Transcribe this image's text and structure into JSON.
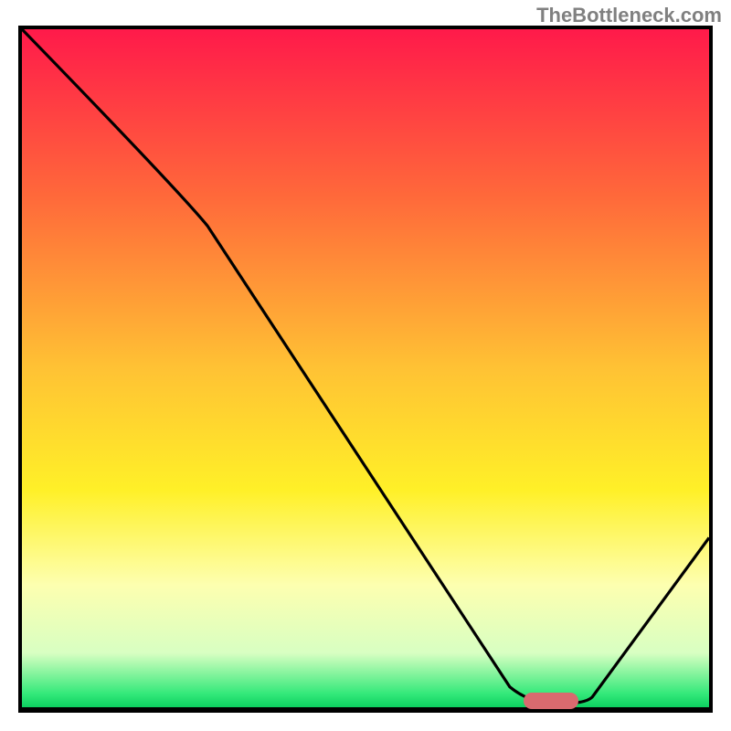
{
  "watermark": "TheBottleneck.com",
  "chart_data": {
    "type": "line",
    "title": "",
    "xlabel": "",
    "ylabel": "",
    "xlim": [
      0,
      100
    ],
    "ylim": [
      0,
      100
    ],
    "gradient_stops": [
      {
        "offset": 0,
        "color": "#ff1a4a"
      },
      {
        "offset": 25,
        "color": "#ff6a3a"
      },
      {
        "offset": 50,
        "color": "#ffc234"
      },
      {
        "offset": 68,
        "color": "#fff028"
      },
      {
        "offset": 82,
        "color": "#fdffb0"
      },
      {
        "offset": 92,
        "color": "#d8ffc2"
      },
      {
        "offset": 98,
        "color": "#34e97a"
      },
      {
        "offset": 100,
        "color": "#0cd060"
      }
    ],
    "curve_points": [
      {
        "x": 0,
        "y": 100
      },
      {
        "x": 23,
        "y": 76
      },
      {
        "x": 27,
        "y": 71
      },
      {
        "x": 71,
        "y": 3
      },
      {
        "x": 74,
        "y": 0.5
      },
      {
        "x": 82,
        "y": 0.5
      },
      {
        "x": 100,
        "y": 25
      }
    ],
    "marker": {
      "x": 77,
      "y": 1,
      "width": 8,
      "color": "#d96a6f"
    }
  }
}
